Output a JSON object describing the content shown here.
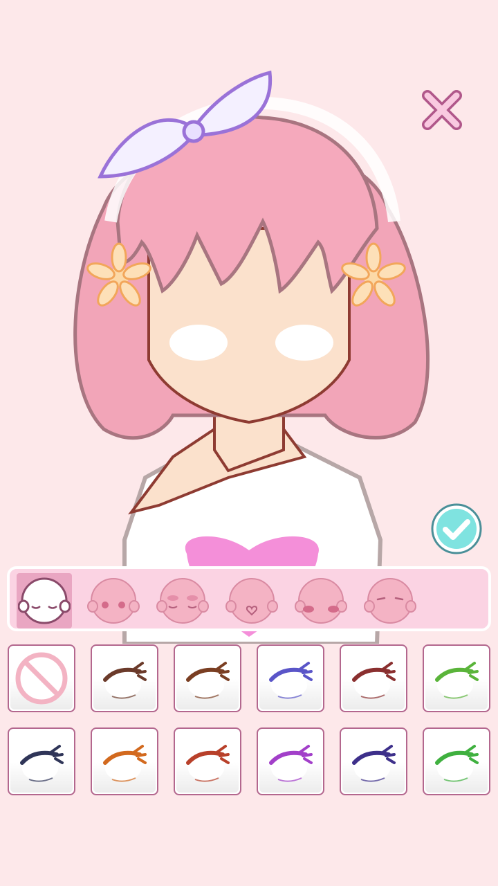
{
  "app": {
    "close_icon": "close-x-icon",
    "confirm_icon": "checkmark-icon"
  },
  "colors": {
    "background": "#fde8ea",
    "category_bar": "#fbd3e3",
    "category_selected": "#e9a6c2",
    "tile_border": "#b3678e",
    "confirm_button": "#7fe3e0"
  },
  "categories": [
    {
      "name": "eyes",
      "icon": "face-closed-eyes-icon",
      "selected": true
    },
    {
      "name": "blush",
      "icon": "face-blush-icon",
      "selected": false
    },
    {
      "name": "eyelids",
      "icon": "face-eyelids-icon",
      "selected": false
    },
    {
      "name": "mouth",
      "icon": "face-mouth-icon",
      "selected": false
    },
    {
      "name": "cheeks",
      "icon": "face-cheeks-icon",
      "selected": false
    },
    {
      "name": "brows",
      "icon": "face-brows-icon",
      "selected": false
    }
  ],
  "eye_options": [
    {
      "icon": "none-icon",
      "color": "#f3b3c3"
    },
    {
      "icon": "eyelash-icon",
      "color": "#6b3a2a"
    },
    {
      "icon": "eyelash-icon",
      "color": "#7a3e22"
    },
    {
      "icon": "eyelash-icon",
      "color": "#5a55c8"
    },
    {
      "icon": "eyelash-icon",
      "color": "#8a2f2f"
    },
    {
      "icon": "eyelash-icon",
      "color": "#5ab43a"
    },
    {
      "icon": "eyelash-icon",
      "color": "#2f3558"
    },
    {
      "icon": "eyelash-icon",
      "color": "#d2691e"
    },
    {
      "icon": "eyelash-icon",
      "color": "#b8402a"
    },
    {
      "icon": "eyelash-icon",
      "color": "#a23fc9"
    },
    {
      "icon": "eyelash-icon",
      "color": "#3d2f8a"
    },
    {
      "icon": "eyelash-icon",
      "color": "#3fb03f"
    }
  ]
}
